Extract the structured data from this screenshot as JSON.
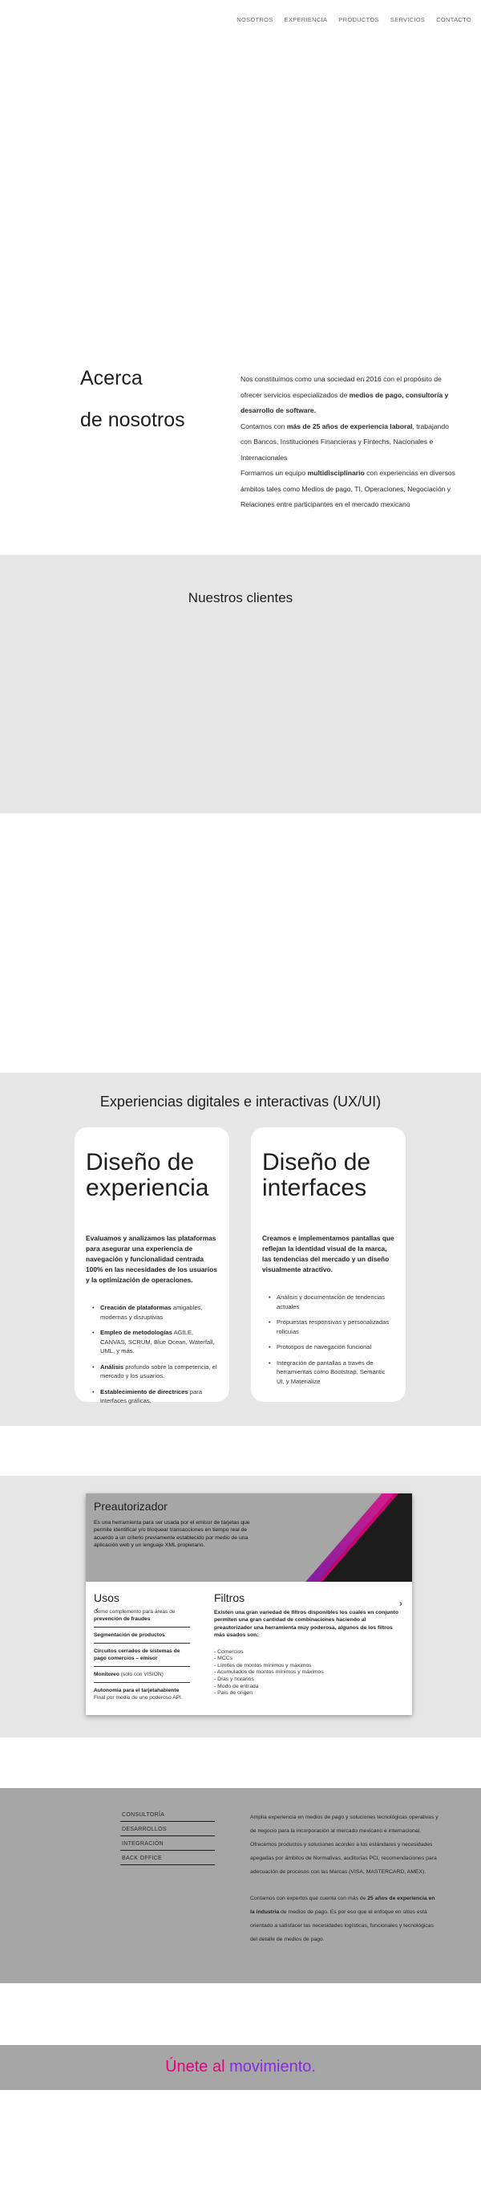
{
  "nav": {
    "items": [
      "NOSOTROS",
      "EXPERIENCIA",
      "PRODUCTOS",
      "SERVICIOS",
      "CONTACTO"
    ]
  },
  "about": {
    "title_line1": "Acerca",
    "title_line2": "de nosotros",
    "p1_a": "Nos constituimos como una sociedad en 2016 con el propósito de ofrecer servicios especializados de ",
    "p1_b": "medios de pago, consultoría y desarrollo de software.",
    "p2_a": "Contamos con ",
    "p2_b": "más de 25 años de experiencia laboral",
    "p2_c": ", trabajando con Bancos, Instituciones Financieras y Fintechs, Nacionales e Internacionales",
    "p3_a": "Formamos un equipo ",
    "p3_b": "multidisciplinario",
    "p3_c": " con experiencias en diversos ámbitos tales como Medios de pago, TI, Operaciones, Negociación y Relaciones entre participantes en el mercado mexicano"
  },
  "clients": {
    "title": "Nuestros clientes"
  },
  "ux": {
    "title": "Experiencias digitales e interactivas (UX/UI)",
    "card1": {
      "title_l1": "Diseño de",
      "title_l2": "experiencia",
      "lead": "Evaluamos y analizamos las plataformas para asegurar una experiencia de navegación y funcionalidad centrada 100% en las necesidades de los usuarios y la optimización de operaciones.",
      "items": [
        {
          "b": "Creación de plataformas",
          "t": " amigables, modernas y disruptivas"
        },
        {
          "b": "Empleo de metodologías",
          "t": " AGILE, CANVAS, SCRUM, Blue Ocean, Waterfall, UML, y más."
        },
        {
          "b": "Análisis",
          "t": " profundo sobre la competencia, el mercado y los usuarios."
        },
        {
          "b": "Establecimiento de directrices",
          "t": " para interfaces gráficas."
        }
      ]
    },
    "card2": {
      "title_l1": "Diseño de",
      "title_l2": "interfaces",
      "lead": "Creamos e implementamos pantallas que reflejan la identidad visual de la marca, las tendencias del mercado y un diseño visualmente atractivo.",
      "items": [
        {
          "b": "",
          "t": "Análisis y documentación de tendencias actuales"
        },
        {
          "b": "",
          "t": "Propuestas responsivas y personalizadas rolicuias"
        },
        {
          "b": "",
          "t": "Prototipos de navegación funcional"
        },
        {
          "b": "",
          "t": "Integración de pantallas a través de herramientas como Bootstrap, Semantic UI, y Materialize"
        }
      ]
    }
  },
  "product": {
    "title": "Preautorizador",
    "desc": "Es una herramienta para ser usada por el emisor de tarjetas que permite identificar y/o bloquear transacciones en tiempo real de acuerdo a un criterio previamente establecido por medio de una aplicación web y un lenguaje XML propietario.",
    "usos_title": "Usos",
    "usos": [
      {
        "t": "Como complemento para áreas de ",
        "b": "prevención de fraudes"
      },
      {
        "t": "",
        "b": "Segmentación de productos"
      },
      {
        "t": "",
        "b": "Circuitos cerrados de sistemas de pago comercios – emisor"
      },
      {
        "t": "",
        "b": "Monitoreo",
        "t2": " (solo con VISION)"
      },
      {
        "t": "",
        "b": "Autonomía para el tarjetahabiente",
        "t2": " Final por medio de uno poderoso API."
      }
    ],
    "filtros_title": "Filtros",
    "filtros_lead": "Existen una gran variedad de filtros disponibles los cuales en conjunto permiten una gran cantidad de combinaciones haciendo al preautorizador una herramienta muy poderosa, algunos de los filtros más usados son:",
    "filtros": [
      "- Comercios",
      "- MCCs",
      "- Límites de montos mínimos y máximos",
      "- Acumulados de montos mínimos y máximos",
      "- Días y horarios",
      "- Modo de entrada",
      "- País de origen"
    ],
    "arrow_left": "‹",
    "arrow_right": "›"
  },
  "footer": {
    "menu": [
      "CONSULTORÍA",
      "DESARROLLOS",
      "INTEGRACIÓN",
      "BACK OFFICE"
    ],
    "text1": "Amplia experiencia en medios de pago y soluciones tecnológicas operativas y de negocio para la incorporación al mercado mexicano e internacional. Ofrecemos productos y soluciones acordes a los estándares y necesidades apegadas por ámbitos de Normativas, auditorías PCI, recomendaciones para adecuación de procesos con las Marcas (VISA, MASTERCARD, AMEX).",
    "text2_a": "Contamos con expertos que cuenta con más de ",
    "text2_b": "25 años de experiencia en la industria",
    "text2_c": " de medios de pago. Es por eso que el enfoque en sitios está orientado a satisfacer las necesidades logísticas, funcionales y tecnológicas del detalle de medios de pago."
  },
  "join": {
    "part1": "Únete al ",
    "part2": "movimiento."
  },
  "colors": {
    "accent_pink": "#e5007e",
    "accent_purple": "#8a2be2",
    "section_gray": "#e6e6e6",
    "footer_gray": "#a6a6a6"
  }
}
